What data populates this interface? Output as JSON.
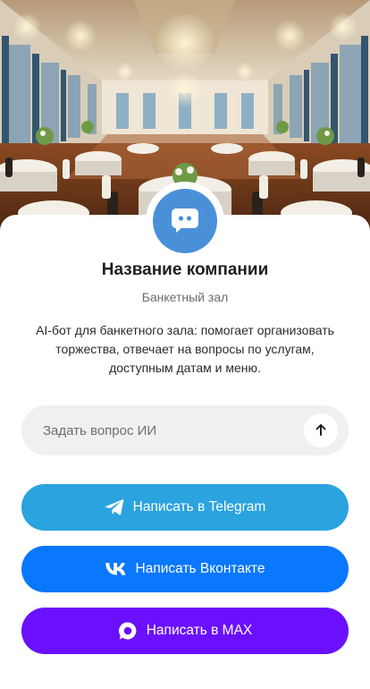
{
  "profile": {
    "name": "Название компании",
    "category": "Банкетный зал",
    "description": "AI-бот для банкетного зала: помогает организовать торжества, отвечает на вопросы по услугам, доступным датам и меню."
  },
  "ask": {
    "placeholder": "Задать вопрос ИИ"
  },
  "actions": [
    {
      "label": "Написать в Telegram",
      "icon": "telegram-icon",
      "color": "#2aa3df"
    },
    {
      "label": "Написать Вконтакте",
      "icon": "vk-icon",
      "color": "#0a77ff"
    },
    {
      "label": "Написать в MAX",
      "icon": "max-icon",
      "color": "#6b10ff"
    }
  ],
  "colors": {
    "avatar": "#4a90d9",
    "input_bg": "#f0f0f0"
  }
}
